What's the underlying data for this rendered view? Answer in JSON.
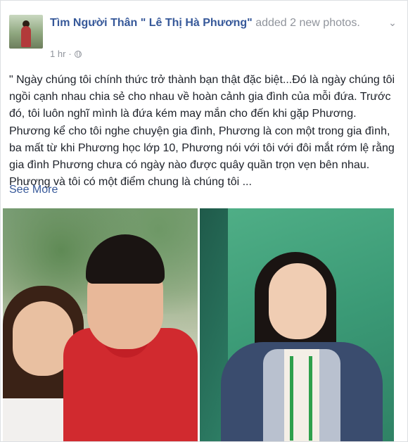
{
  "post": {
    "page_name": "Tìm Người Thân \" Lê Thị Hà Phương\"",
    "action_text": " added 2 new photos.",
    "time": "1 hr",
    "separator": "·",
    "body": "\" Ngày chúng tôi chính thức trở thành bạn thật đặc biệt...Đó là ngày chúng tôi ngồi cạnh nhau chia sẻ cho nhau về hoàn cảnh gia đình của mỗi đứa. Trước đó, tôi luôn nghĩ mình là đứa kém may mắn cho đến khi gặp Phương. Phương kể cho tôi nghe chuyện gia đình, Phương là con một trong gia đình, ba mất từ khi Phương học lớp 10, Phương nói với tôi với đôi mắt rớm lệ rằng gia đình Phương chưa có ngày nào được quây quần trọn vẹn bên nhau. Phương và tôi có một điểm chung là chúng tôi ...",
    "see_more": "See More"
  },
  "icons": {
    "privacy": "globe-icon",
    "menu": "chevron-down-icon"
  },
  "colors": {
    "link": "#365899",
    "text": "#1d2129",
    "meta": "#90949c"
  }
}
